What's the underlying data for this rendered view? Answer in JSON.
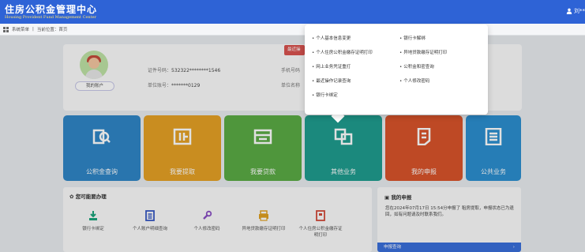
{
  "header": {
    "title": "住房公积金管理中心",
    "subtitle": "Housing Provident Fund Management Center",
    "user": "刘**"
  },
  "breadcrumb": {
    "menu": "系统菜单",
    "location": "当前位置：首页"
  },
  "profile": {
    "my_account": "我的账户",
    "id_label": "证件号码：",
    "id_value": "532322********1546",
    "unit_label": "单位账号：",
    "unit_value": "*******0129",
    "phone_label": "手机号码",
    "unit_name_label": "单位名称",
    "recent_tag": "最近操"
  },
  "tiles": [
    {
      "label": "公积金查询",
      "icon": "search-doc-icon",
      "color": "#2f86c7"
    },
    {
      "label": "我要提取",
      "icon": "withdraw-icon",
      "color": "#e5a125"
    },
    {
      "label": "我要贷款",
      "icon": "loan-icon",
      "color": "#5bab45"
    },
    {
      "label": "其他业务",
      "icon": "other-business-icon",
      "color": "#1f9c8f"
    },
    {
      "label": "我的申报",
      "icon": "declaration-icon",
      "color": "#d9542b"
    },
    {
      "label": "公共业务",
      "icon": "public-business-icon",
      "color": "#2c8fd0"
    }
  ],
  "services": {
    "title": "您可能要办理",
    "items": [
      {
        "label": "银行卡绑定",
        "icon": "bank-card-bind-icon",
        "color": "#1aa37a"
      },
      {
        "label": "个人账户明细查询",
        "icon": "account-detail-icon",
        "color": "#3658c4"
      },
      {
        "label": "个人修改密码",
        "icon": "wrench-icon",
        "color": "#8a4fc4"
      },
      {
        "label": "异地贷款缴存证明打印",
        "icon": "print-icon",
        "color": "#e0a020"
      },
      {
        "label": "个人住房公积金缴存证明打印",
        "icon": "certificate-print-icon",
        "color": "#d24a3a"
      }
    ]
  },
  "notice": {
    "title": "我的申报",
    "text": "您在2024年07月17日 15:54分申报了 租房提取，申报状态已为退回，如有问题请及时联系我们。",
    "button": "申报查询"
  },
  "dropdown": {
    "left": [
      "个人基本信息变更",
      "个人住房公积金缴存证明打印",
      "网上业务凭证重打",
      "最近操作记录查询",
      "银行卡绑定"
    ],
    "right": [
      "银行卡解绑",
      "异地贷款缴存证明打印",
      "公积金和密查询",
      "个人修改密码"
    ]
  }
}
